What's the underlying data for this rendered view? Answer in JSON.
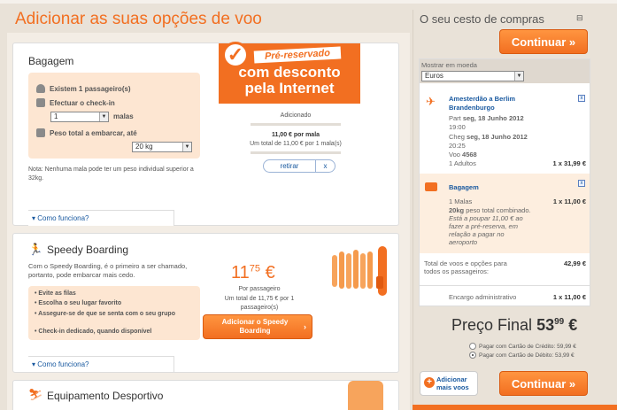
{
  "page": {
    "title": "Adicionar as suas opções de voo"
  },
  "baggage": {
    "title": "Bagagem",
    "passengers_text": "Existem 1 passageiro(s)",
    "checkin_label": "Efectuar o check-in",
    "bags_value": "1",
    "bags_unit": "malas",
    "weight_label": "Peso total a embarcar, até",
    "weight_value": "20 kg",
    "note": "Nota: Nenhuma mala pode ter um peso individual superior a 32kg.",
    "stamp_text": "Pré-reservado",
    "promo_line1": "com desconto",
    "promo_line2": "pela Internet",
    "added_label": "Adicionado",
    "price_per_bag": "11,00 € por mala",
    "price_total": "Um total de 11,00 € por 1 mala(s)",
    "remove_label": "retirar",
    "remove_x": "x",
    "how_link": "Como funciona?"
  },
  "speedy": {
    "title": "Speedy Boarding",
    "intro": "Com o Speedy Boarding, é o primeiro a ser chamado, portanto, pode embarcar mais cedo.",
    "bullets": [
      "Evite as filas",
      "Escolha o seu lugar favorito",
      "Assegure-se de que se senta com o seu grupo",
      "Check-in dedicado, quando disponível"
    ],
    "price_int": "11",
    "price_dec": "75",
    "price_cur": "€",
    "per_passenger": "Por passageiro",
    "total_line": "Um total de 11,75 € por 1 passageiro(s)",
    "add_button": "Adicionar o Speedy Boarding",
    "how_link": "Como funciona?"
  },
  "sports": {
    "title": "Equipamento Desportivo"
  },
  "cart": {
    "title": "O seu cesto de compras",
    "continue_label": "Continuar",
    "currency_label": "Mostrar em moeda",
    "currency_value": "Euros",
    "flight": {
      "route": "Amesterdão a Berlim Brandenburgo",
      "dep_label": "Part",
      "dep_date": "seg, 18 Junho 2012",
      "dep_time": "19:00",
      "arr_label": "Cheg",
      "arr_date": "seg, 18 Junho 2012",
      "arr_time": "20:25",
      "flight_label": "Voo",
      "flight_no": "4568",
      "pax": "1 Adultos",
      "pax_price": "1 x 31,99 €"
    },
    "bag": {
      "title": "Bagagem",
      "qty": "1 Malas",
      "qty_price": "1 x 11,00 €",
      "desc_bold": "20kg",
      "desc": "peso total combinado.",
      "saving": "Está a poupar 11,00 € ao fazer a pré-reserva, em relação a pagar no aeroporto"
    },
    "total_label": "Total de voos e opções para todos os passageiros:",
    "total_value": "42,99 €",
    "admin_label": "Encargo administrativo",
    "admin_value": "1 x 11,00 €",
    "final_label": "Preço Final",
    "final_int": "53",
    "final_dec": "99",
    "final_cur": "€",
    "pay_credit": "Pagar com Cartão de Crédito: 59,99 €",
    "pay_debit": "Pagar com Cartão de Débito: 53,99 €",
    "add_more_line1": "Adicionar",
    "add_more_line2": "mais voos"
  }
}
